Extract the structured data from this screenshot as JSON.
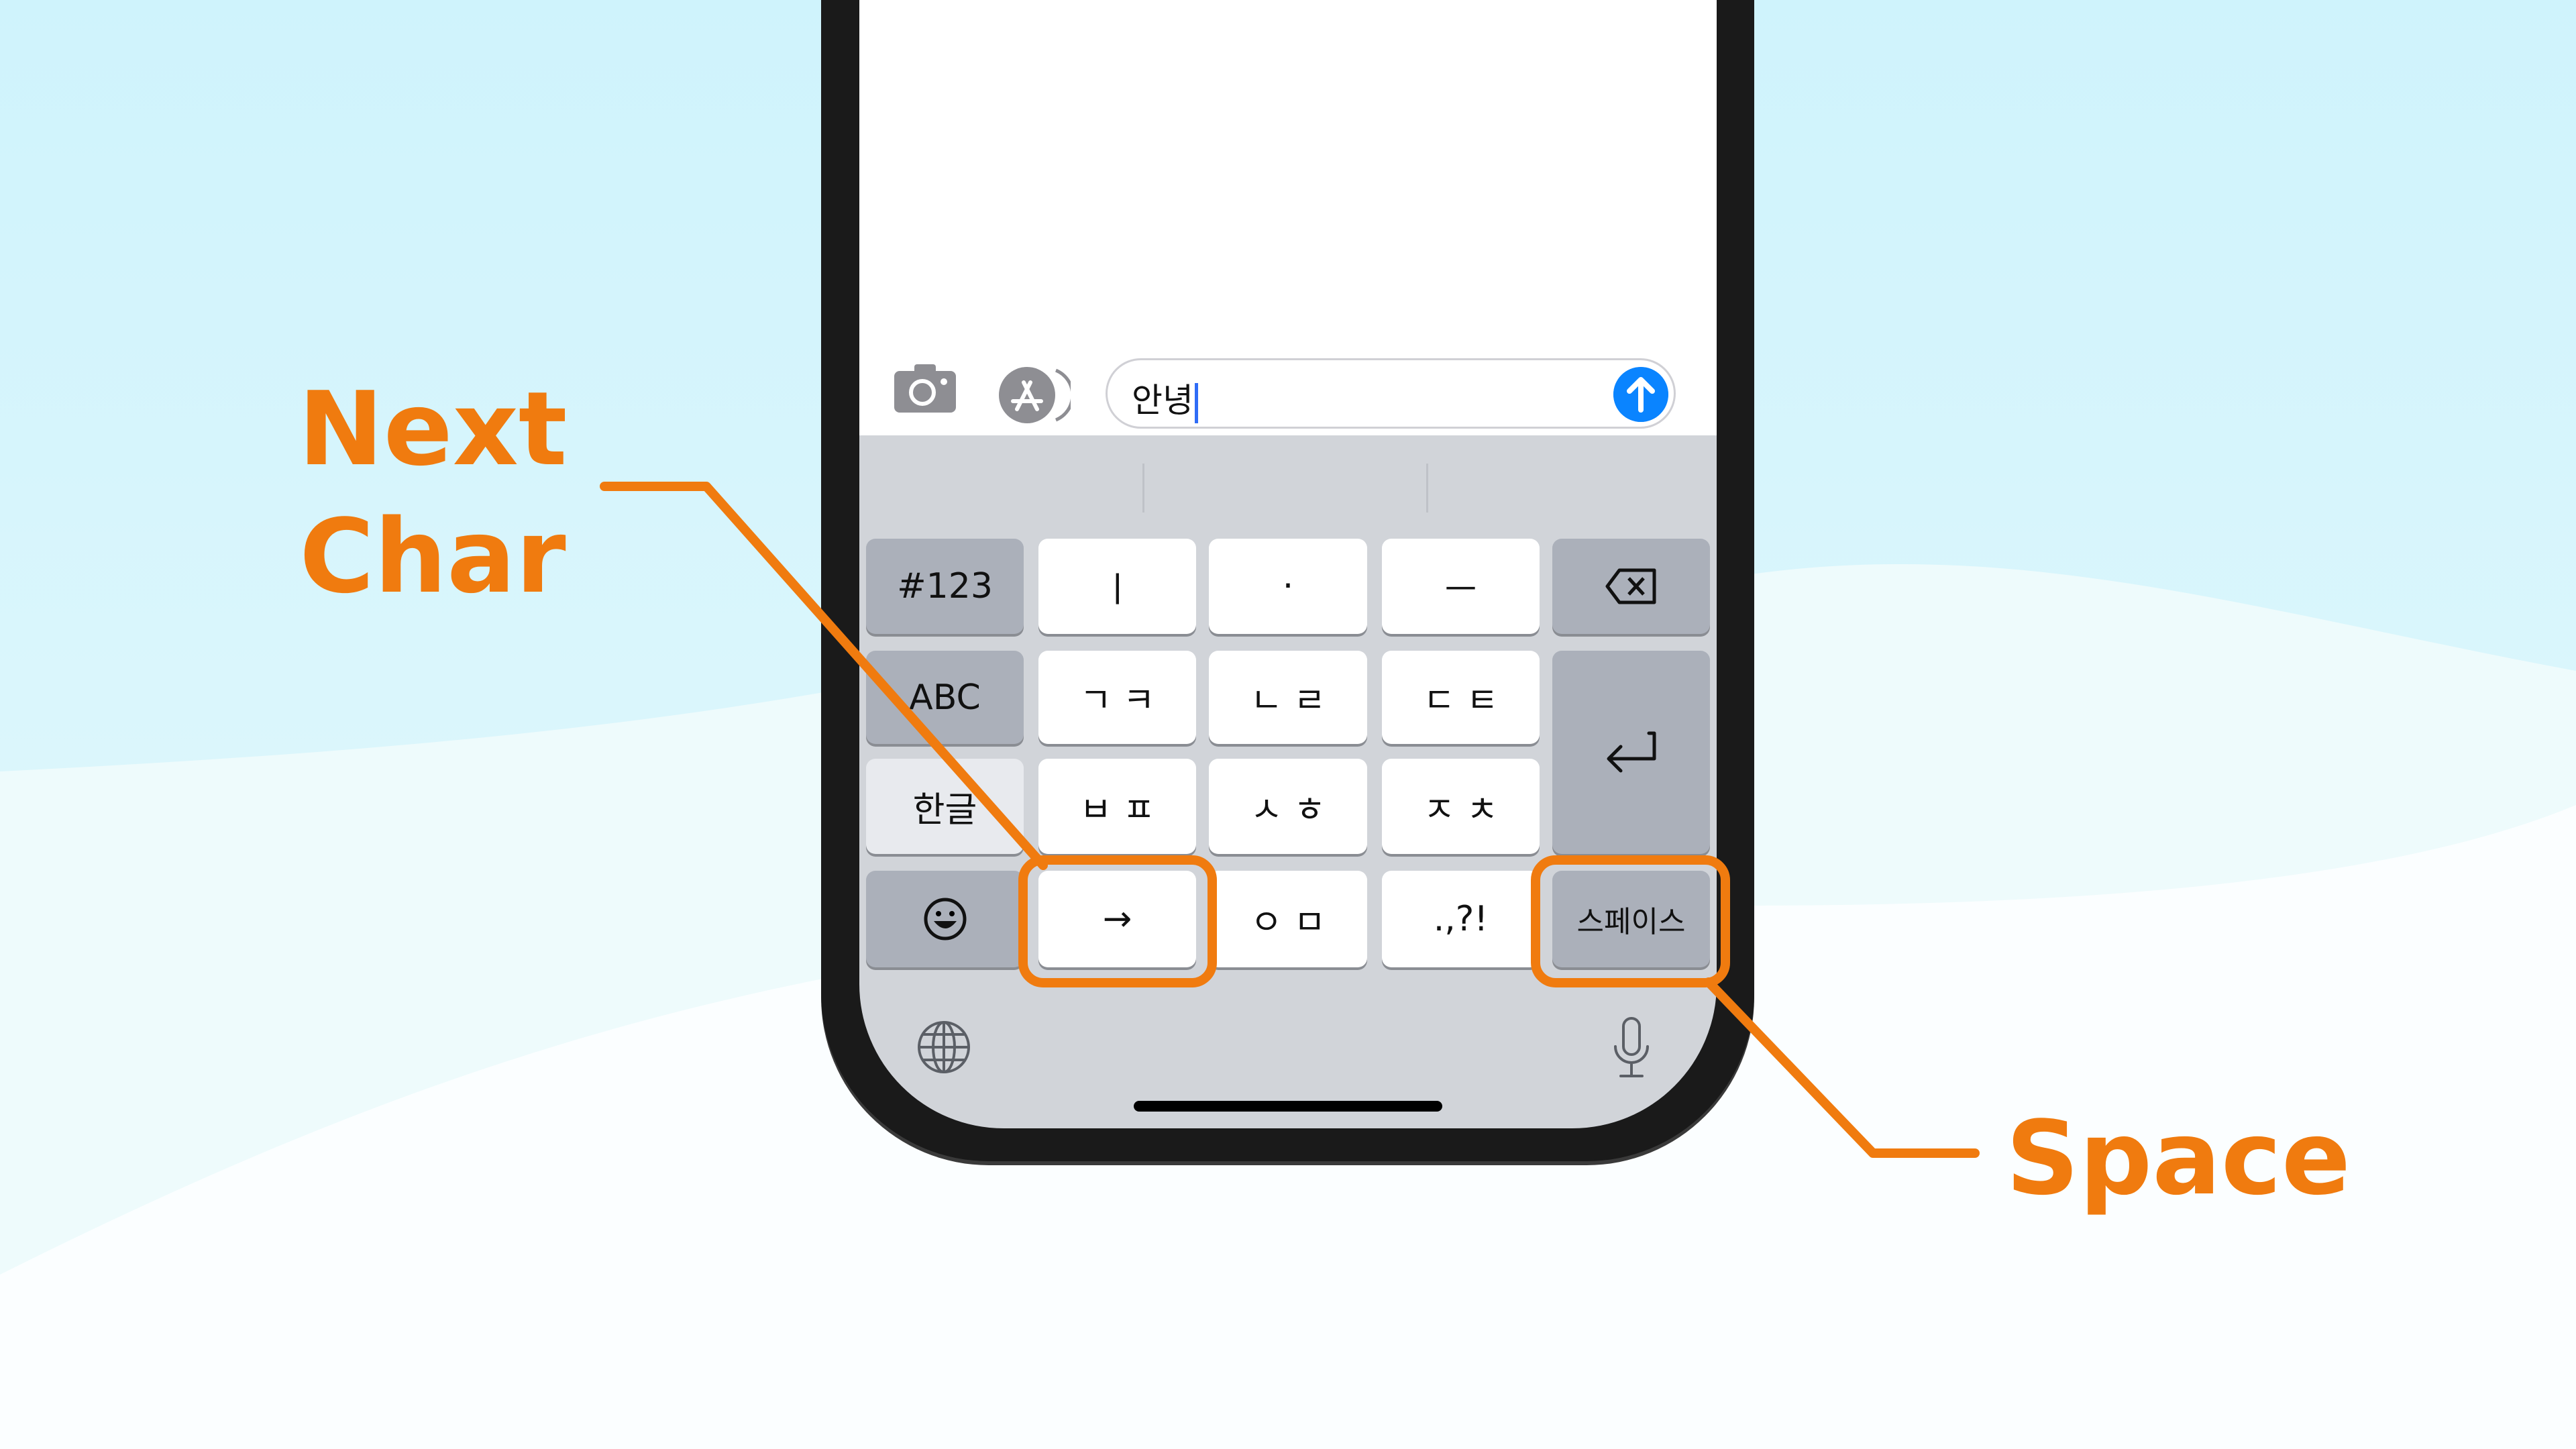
{
  "annotations": {
    "next_char": [
      "Next",
      "Char"
    ],
    "space": "Space",
    "color": "#f07b0f"
  },
  "message_bar": {
    "camera_icon": "camera-icon",
    "apps_icon": "app-store-icon",
    "input_value": "안녕",
    "send_icon": "arrow-up-icon",
    "send_color": "#0a84ff"
  },
  "keyboard": {
    "rows": [
      [
        "#123",
        "ㅣ",
        "·",
        "ㅡ",
        "delete-icon"
      ],
      [
        "ABC",
        "ㄱ ㅋ",
        "ㄴ ㄹ",
        "ㄷ ㅌ",
        "return-icon"
      ],
      [
        "한글",
        "ㅂ ㅍ",
        "ㅅ ㅎ",
        "ㅈ ㅊ"
      ],
      [
        "emoji-icon",
        "→",
        "ㅇ ㅁ",
        ".,?!",
        "스페이스"
      ]
    ],
    "globe_icon": "globe-icon",
    "mic_icon": "microphone-icon"
  }
}
